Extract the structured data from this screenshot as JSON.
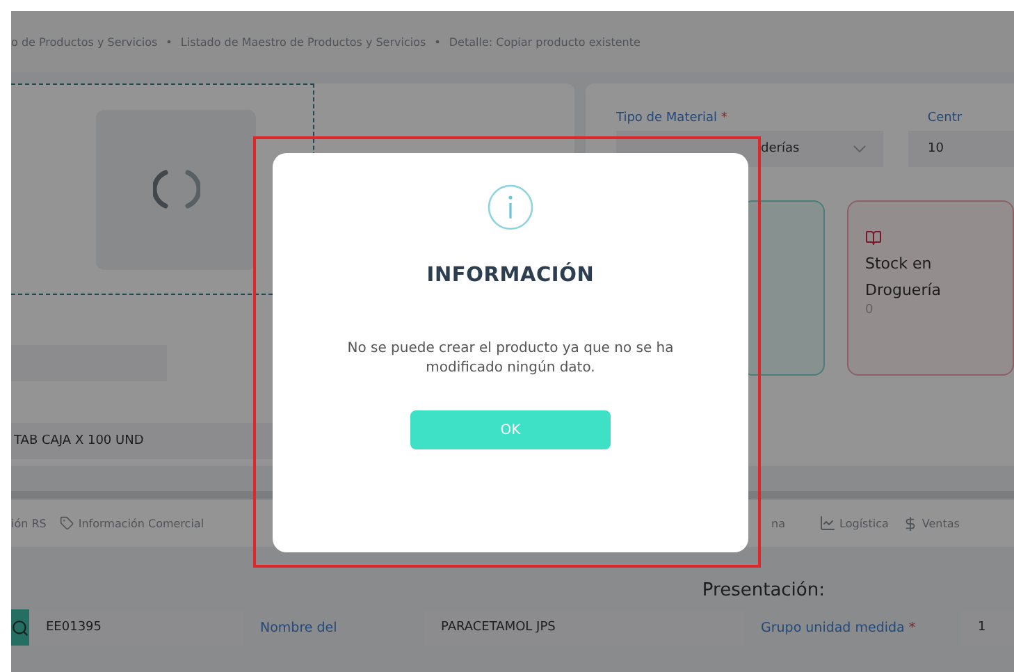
{
  "breadcrumb": [
    "o de Productos y Servicios",
    "Listado de Maestro de Productos y Servicios",
    "Detalle: Copiar producto existente"
  ],
  "breadcrumb_separator": "•",
  "product_fields": [
    {
      "kind": "empty"
    },
    {
      "kind": "filled",
      "value": "TAB CAJA X 100 UND"
    }
  ],
  "material": {
    "label": "Tipo de Material",
    "required_mark": "*",
    "value": "derías",
    "next_label": "Centr",
    "next_value": "10"
  },
  "stock_cards": [
    {
      "kind": "teal"
    },
    {
      "kind": "red",
      "title": "Stock en Droguería",
      "value": "0"
    }
  ],
  "tabs": [
    {
      "label": "ión RS",
      "kind": "plain"
    },
    {
      "label": "Información Comercial",
      "kind": "tag"
    },
    {
      "label": "na",
      "kind": "plain"
    },
    {
      "label": "Logística",
      "kind": "chart"
    },
    {
      "label": "Ventas",
      "kind": "dollar"
    }
  ],
  "section_title": "Presentación:",
  "form_row": {
    "code": "EE01395",
    "name_label": "Nombre del",
    "name_value": "PARACETAMOL JPS",
    "group_label": "Grupo unidad medida",
    "group_required": "*",
    "group_value": "1"
  },
  "dialog": {
    "title": "INFORMACIÓN",
    "message": "No se puede crear el producto ya que no se ha modificado ningún dato.",
    "button": "OK"
  }
}
